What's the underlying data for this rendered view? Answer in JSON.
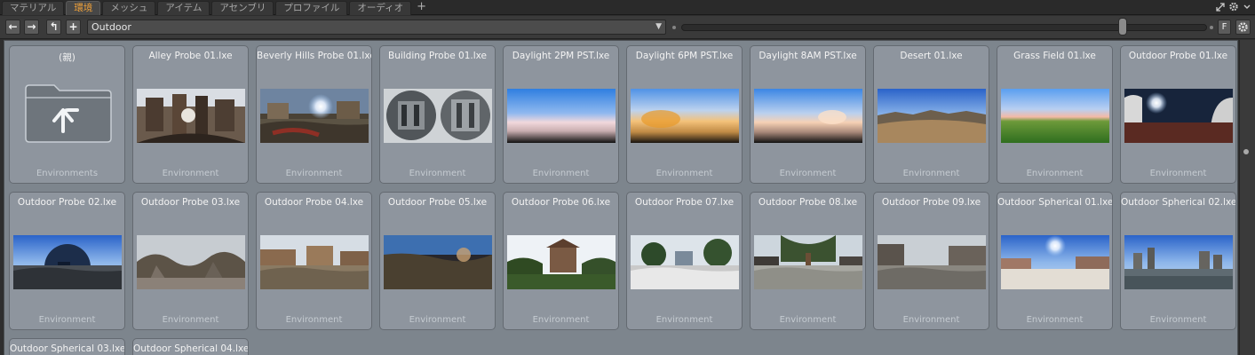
{
  "tabs": [
    {
      "label": "マテリアル",
      "active": false
    },
    {
      "label": "環境",
      "active": true
    },
    {
      "label": "メッシュ",
      "active": false
    },
    {
      "label": "アイテム",
      "active": false
    },
    {
      "label": "アセンブリ",
      "active": false
    },
    {
      "label": "プロファイル",
      "active": false
    },
    {
      "label": "オーディオ",
      "active": false
    }
  ],
  "tab_add_label": "+",
  "toolbar": {
    "back_label": "←",
    "forward_label": "→",
    "up_label": "↰",
    "add_label": "+",
    "path": "Outdoor",
    "favorite_label": "F",
    "zoom_level": 0.84
  },
  "icons": {
    "tab_bar": [
      "expand-icon",
      "gear-icon",
      "dropdown-icon"
    ],
    "toolbar": [
      "back-arrow-icon",
      "forward-arrow-icon",
      "up-folder-icon",
      "add-icon",
      "chevron-down-icon",
      "gear-icon"
    ],
    "parent_folder": "folder-up-icon"
  },
  "colors": {
    "accent_tab": "#f0a13a",
    "panel_background": "#7d858d",
    "card_background": "#8e959e"
  },
  "items": [
    {
      "name": "(親)",
      "kind": "Environments",
      "thumb": "folder"
    },
    {
      "name": "Alley Probe 01.lxe",
      "kind": "Environment",
      "thumb": "alley"
    },
    {
      "name": "Beverly Hills Probe 01.lxe",
      "kind": "Environment",
      "thumb": "beverly"
    },
    {
      "name": "Building Probe 01.lxe",
      "kind": "Environment",
      "thumb": "building"
    },
    {
      "name": "Daylight 2PM PST.lxe",
      "kind": "Environment",
      "thumb": "day2"
    },
    {
      "name": "Daylight 6PM PST.lxe",
      "kind": "Environment",
      "thumb": "day6"
    },
    {
      "name": "Daylight 8AM PST.lxe",
      "kind": "Environment",
      "thumb": "day8"
    },
    {
      "name": "Desert 01.lxe",
      "kind": "Environment",
      "thumb": "desert"
    },
    {
      "name": "Grass Field 01.lxe",
      "kind": "Environment",
      "thumb": "grass"
    },
    {
      "name": "Outdoor Probe 01.lxe",
      "kind": "Environment",
      "thumb": "op01"
    },
    {
      "name": "Outdoor Probe 02.lxe",
      "kind": "Environment",
      "thumb": "op02"
    },
    {
      "name": "Outdoor Probe 03.lxe",
      "kind": "Environment",
      "thumb": "op03"
    },
    {
      "name": "Outdoor Probe 04.lxe",
      "kind": "Environment",
      "thumb": "op04"
    },
    {
      "name": "Outdoor Probe 05.lxe",
      "kind": "Environment",
      "thumb": "op05"
    },
    {
      "name": "Outdoor Probe 06.lxe",
      "kind": "Environment",
      "thumb": "op06"
    },
    {
      "name": "Outdoor Probe 07.lxe",
      "kind": "Environment",
      "thumb": "op07"
    },
    {
      "name": "Outdoor Probe 08.lxe",
      "kind": "Environment",
      "thumb": "op08"
    },
    {
      "name": "Outdoor Probe 09.lxe",
      "kind": "Environment",
      "thumb": "op09"
    },
    {
      "name": "Outdoor Spherical 01.lxe",
      "kind": "Environment",
      "thumb": "os01"
    },
    {
      "name": "Outdoor Spherical 02.lxe",
      "kind": "Environment",
      "thumb": "os02"
    },
    {
      "name": "Outdoor Spherical 03.lxe",
      "kind": "",
      "thumb": "none"
    },
    {
      "name": "Outdoor Spherical 04.lxe",
      "kind": "",
      "thumb": "none"
    }
  ]
}
